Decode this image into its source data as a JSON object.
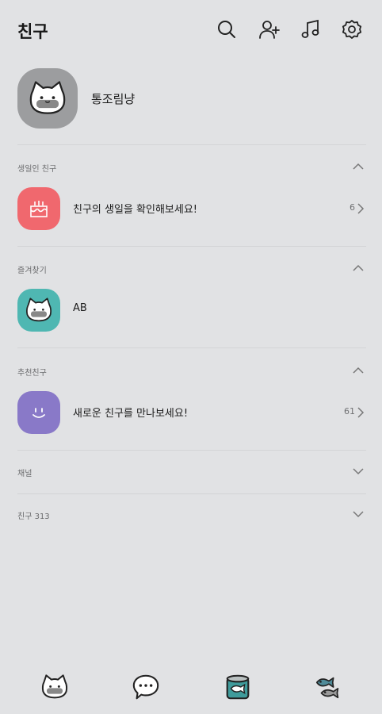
{
  "header": {
    "title": "친구",
    "icons": [
      "search-icon",
      "add-friend-icon",
      "music-icon",
      "settings-icon"
    ]
  },
  "profile": {
    "name": "통조림냥"
  },
  "sections": {
    "birthday": {
      "label": "생일인 친구",
      "row_text": "친구의 생일을 확인해보세요!",
      "count": "6",
      "avatar_color": "#f0686e"
    },
    "favorites": {
      "label": "즐겨찾기",
      "row_text": "AB",
      "avatar_color": "#4fb7b2"
    },
    "recommended": {
      "label": "추천친구",
      "row_text": "새로운 친구를 만나보세요!",
      "count": "61",
      "avatar_color": "#8979c8"
    },
    "channel": {
      "label": "채널"
    },
    "friends": {
      "label": "친구 313"
    }
  },
  "tabbar": {
    "tabs": [
      "friends-tab-icon",
      "chat-tab-icon",
      "can-tab-icon",
      "fish-tab-icon"
    ]
  },
  "colors": {
    "background": "#e1e2e4",
    "divider": "#d3d4d6",
    "profile_avatar": "#9c9d9f",
    "accent_teal": "#3f9b9b"
  }
}
